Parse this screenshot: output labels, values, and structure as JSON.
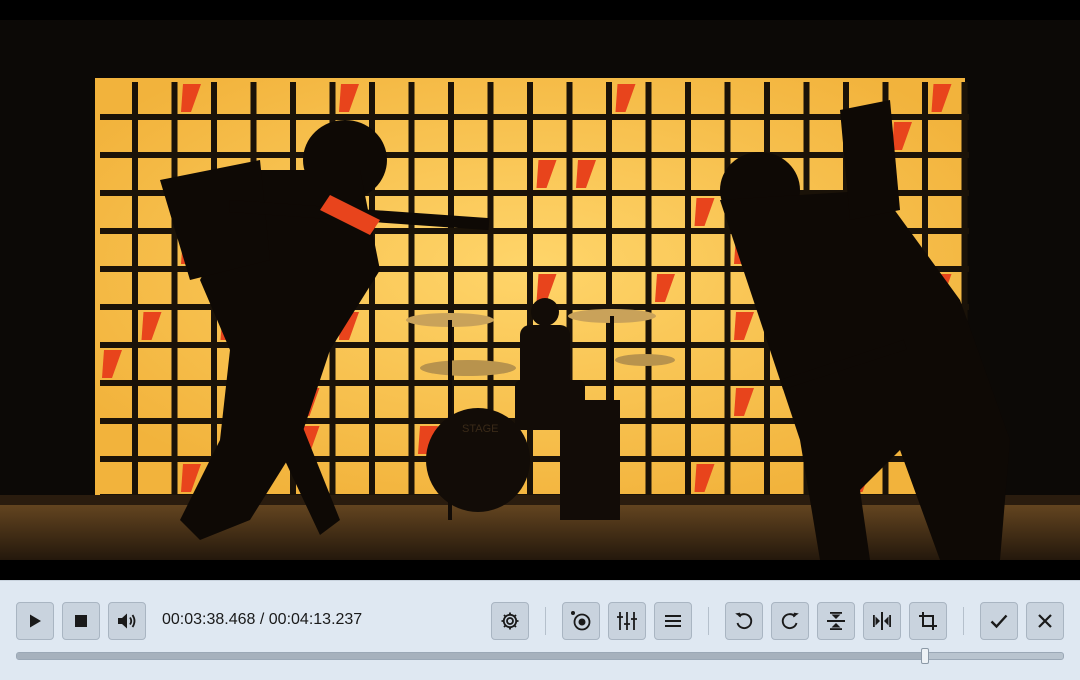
{
  "player": {
    "current_time": "00:03:38.468",
    "separator": "/",
    "total_time": "00:04:13.237",
    "progress_fraction": 0.867,
    "accent_color": "#f7c846"
  },
  "video": {
    "drum_logo_text": "STAGE",
    "led_wall_color": "#f5c04a",
    "led_red_color": "#e8441c"
  },
  "buttons": {
    "play": "play-icon",
    "stop": "stop-icon",
    "volume": "speaker-icon",
    "settings": "gear-icon",
    "record": "record-icon",
    "adjust": "sliders-icon",
    "menu": "hamburger-icon",
    "rotate_left": "rotate-left-icon",
    "rotate_right": "rotate-right-icon",
    "flip_vertical": "flip-vertical-icon",
    "flip_horizontal": "flip-horizontal-icon",
    "crop": "crop-icon",
    "confirm": "checkmark-icon",
    "close": "close-icon"
  }
}
